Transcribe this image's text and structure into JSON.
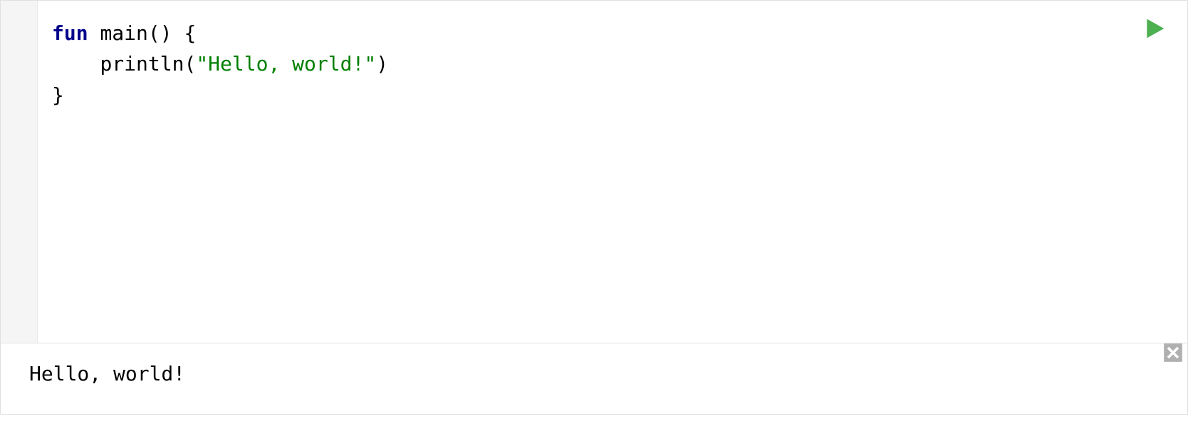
{
  "editor": {
    "code": {
      "line1": {
        "keyword": "fun",
        "space1": " ",
        "name": "main",
        "parens": "()",
        "space2": " ",
        "brace_open": "{"
      },
      "line2": {
        "indent": "    ",
        "call": "println",
        "paren_open": "(",
        "string": "\"Hello, world!\"",
        "paren_close": ")"
      },
      "line3": {
        "brace_close": "}"
      }
    }
  },
  "output": {
    "text": "Hello, world!"
  },
  "icons": {
    "run": "run-icon",
    "close": "close-icon"
  },
  "colors": {
    "keyword": "#00008b",
    "string": "#008000",
    "run_fill": "#4caf50",
    "close_fill": "#a9a9a9"
  }
}
